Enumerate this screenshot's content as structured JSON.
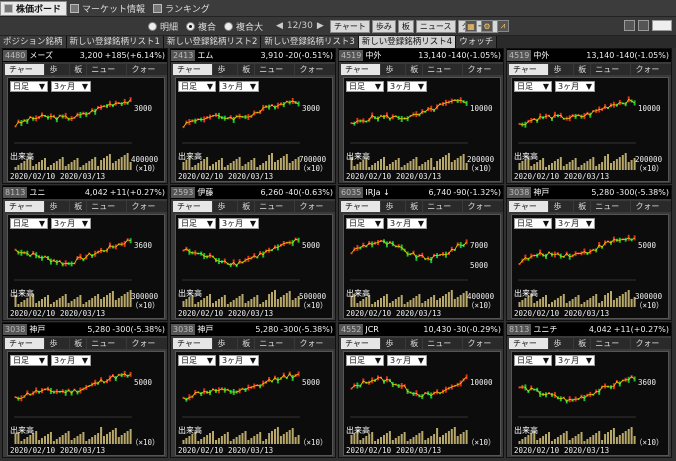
{
  "topbar": {
    "tabs": [
      {
        "label": "株価ボード",
        "icon": "board-icon",
        "active": true
      },
      {
        "label": "マーケット情報",
        "icon": "market-icon",
        "active": false
      },
      {
        "label": "ランキング",
        "icon": "ranking-icon",
        "active": false
      }
    ]
  },
  "toolbar": {
    "radios": [
      {
        "label": "明細",
        "checked": false
      },
      {
        "label": "複合",
        "checked": true
      },
      {
        "label": "複合大",
        "checked": false
      }
    ],
    "pager": "12/30",
    "buttons": [
      "チャート",
      "歩み",
      "板",
      "ニュース",
      "クォート"
    ]
  },
  "listtabs": [
    "ポジション銘柄",
    "新しい登録銘柄リスト1",
    "新しい登録銘柄リスト2",
    "新しい登録銘柄リスト3",
    "新しい登録銘柄リスト4",
    "ウォッチ"
  ],
  "panel_tabs": [
    "チャート",
    "歩み",
    "板",
    "ニュース",
    "クォート"
  ],
  "selects": {
    "period": "日足",
    "range": "3ヶ月"
  },
  "volume_label": "出来高",
  "dates": [
    "2020/02/10",
    "2020/03/13"
  ],
  "colors": {
    "up": "#e0301e",
    "down": "#12c23a",
    "ma": "#e8d200",
    "volume": "#b8a86a"
  },
  "panels": [
    {
      "code": "4480",
      "name": "メーズ",
      "price": "3,200",
      "change": "+185(+6.14%)",
      "ylab": [
        "3000"
      ],
      "vol": "400000",
      "unit": "（×10）",
      "trend": "up"
    },
    {
      "code": "2413",
      "name": "エム",
      "price": "3,910",
      "change": "-20(-0.51%)",
      "ylab": [
        "3000"
      ],
      "vol": "700000",
      "unit": "（×10）",
      "trend": "up"
    },
    {
      "code": "4519",
      "name": "中外",
      "price": "13,140",
      "change": "-140(-1.05%)",
      "ylab": [
        "10000"
      ],
      "vol": "200000",
      "unit": "（×10）",
      "trend": "up"
    },
    {
      "code": "4519",
      "name": "中外",
      "price": "13,140",
      "change": "-140(-1.05%)",
      "ylab": [
        "10000"
      ],
      "vol": "200000",
      "unit": "（×10）",
      "trend": "up"
    },
    {
      "code": "8113",
      "name": "ユニ",
      "price": "4,042",
      "change": "+11(+0.27%)",
      "ylab": [
        "3600"
      ],
      "vol": "300000",
      "unit": "（×10）",
      "trend": "vee"
    },
    {
      "code": "2593",
      "name": "伊藤",
      "price": "6,260",
      "change": "-40(-0.63%)",
      "ylab": [
        "5000"
      ],
      "vol": "500000",
      "unit": "（×10）",
      "trend": "vee"
    },
    {
      "code": "6035",
      "name": "IRJa ↓",
      "price": "6,740",
      "change": "-90(-1.32%)",
      "ylab": [
        "7000",
        "5000"
      ],
      "vol": "400000",
      "unit": "（×10）",
      "trend": "wave"
    },
    {
      "code": "3038",
      "name": "神戸",
      "price": "5,280",
      "change": "-300(-5.38%)",
      "ylab": [
        "5000"
      ],
      "vol": "300000",
      "unit": "（×10）",
      "trend": "up"
    },
    {
      "code": "3038",
      "name": "神戸",
      "price": "5,280",
      "change": "-300(-5.38%)",
      "ylab": [
        "5000"
      ],
      "vol": "",
      "unit": "（×10）",
      "trend": "up"
    },
    {
      "code": "3038",
      "name": "神戸",
      "price": "5,280",
      "change": "-300(-5.38%)",
      "ylab": [
        "5000"
      ],
      "vol": "",
      "unit": "（×10）",
      "trend": "up"
    },
    {
      "code": "4552",
      "name": "JCR",
      "price": "10,430",
      "change": "-30(-0.29%)",
      "ylab": [
        "10000"
      ],
      "vol": "",
      "unit": "（×10）",
      "trend": "wave"
    },
    {
      "code": "8113",
      "name": "ユニチ",
      "price": "4,042",
      "change": "+11(+0.27%)",
      "ylab": [
        "3600"
      ],
      "vol": "",
      "unit": "（×10）",
      "trend": "vee"
    }
  ]
}
